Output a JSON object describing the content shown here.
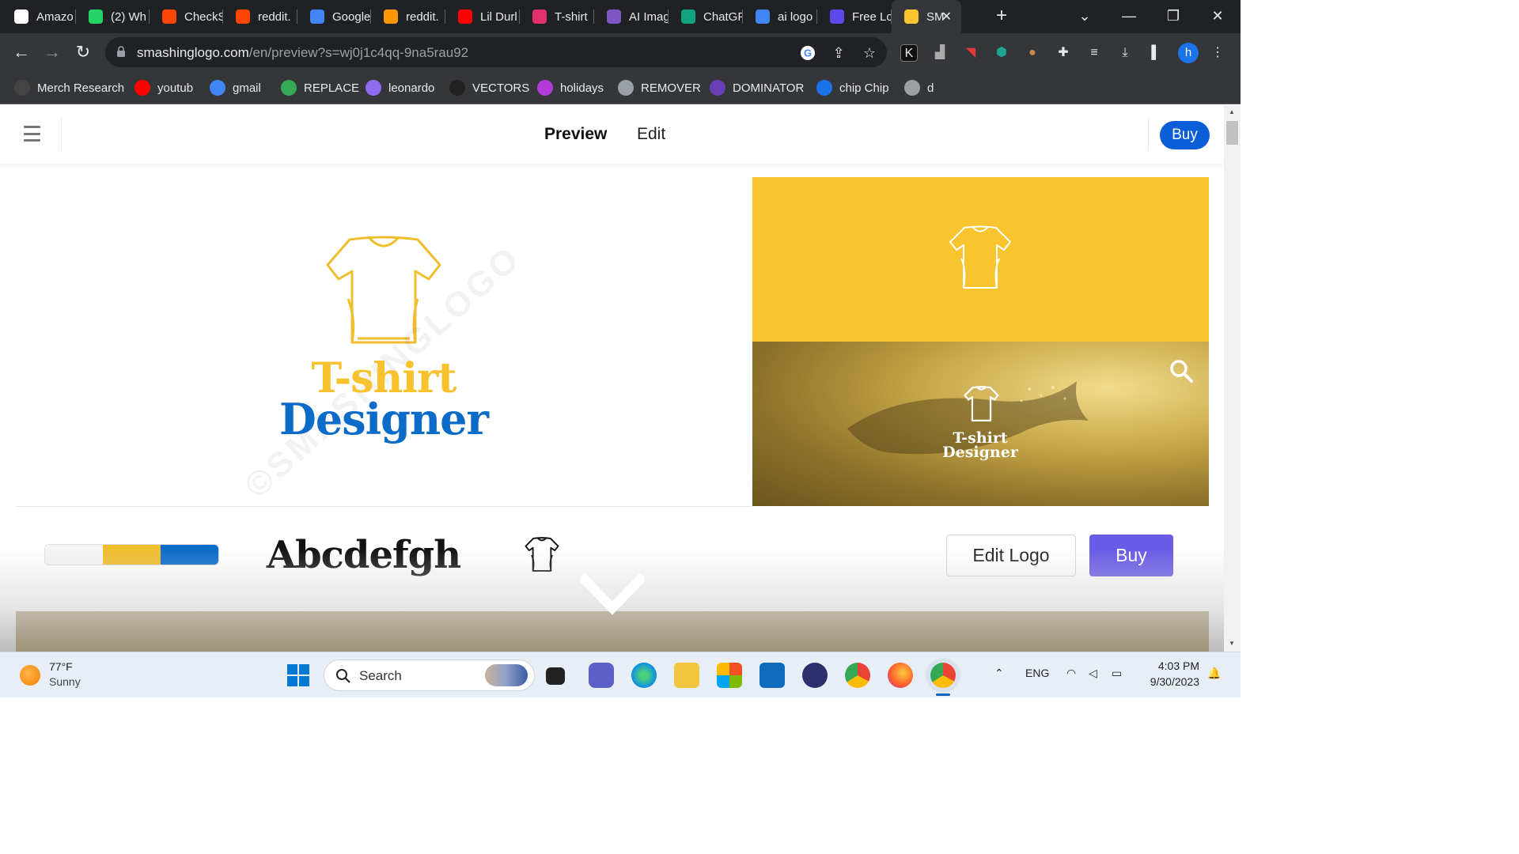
{
  "browser": {
    "tabs": [
      {
        "title": "Amazo",
        "icon": "amazon-icon",
        "color": "#ffffff"
      },
      {
        "title": "(2) Wh",
        "icon": "whatsapp-icon",
        "color": "#25d366"
      },
      {
        "title": "CheckS",
        "icon": "reddit-icon",
        "color": "#ff4500"
      },
      {
        "title": "reddit.",
        "icon": "reddit-icon",
        "color": "#ff4500"
      },
      {
        "title": "Google",
        "icon": "google-translate-icon",
        "color": "#4285f4"
      },
      {
        "title": "reddit.",
        "icon": "fire-icon",
        "color": "#ff9800"
      },
      {
        "title": "Lil Durl",
        "icon": "youtube-icon",
        "color": "#ff0000"
      },
      {
        "title": "T-shirt",
        "icon": "instagram-icon",
        "color": "#e1306c"
      },
      {
        "title": "AI Imag",
        "icon": "ai-image-icon",
        "color": "#7e57c2"
      },
      {
        "title": "ChatGF",
        "icon": "chatgpt-icon",
        "color": "#10a37f"
      },
      {
        "title": "ai logo",
        "icon": "google-icon",
        "color": "#4285f4"
      },
      {
        "title": "Free Lc",
        "icon": "free-logo-icon",
        "color": "#5b4ae8"
      },
      {
        "title": "SM",
        "icon": "smashinglogo-icon",
        "color": "#f8c52f"
      }
    ],
    "url_host": "smashinglogo.com",
    "url_path": "/en/preview?s=wj0j1c4qq-9na5rau92",
    "profile_initial": "h",
    "bookmarks": [
      {
        "label": "Merch Research",
        "icon": "merch-research-icon",
        "color": "#444444"
      },
      {
        "label": "youtub",
        "icon": "youtube-icon",
        "color": "#ff0000"
      },
      {
        "label": "gmail",
        "icon": "google-icon",
        "color": "#4285f4"
      },
      {
        "label": "REPLACE",
        "icon": "replace-icon",
        "color": "#34a853"
      },
      {
        "label": "leonardo",
        "icon": "leonardo-icon",
        "color": "#8e6cf1"
      },
      {
        "label": "VECTORS",
        "icon": "vectors-icon",
        "color": "#222222"
      },
      {
        "label": "holidays",
        "icon": "holidays-icon",
        "color": "#b23ad8"
      },
      {
        "label": "REMOVER",
        "icon": "remover-icon",
        "color": "#9aa0a6"
      },
      {
        "label": "DOMINATOR",
        "icon": "dominator-icon",
        "color": "#6a3fb5"
      },
      {
        "label": "chip Chip",
        "icon": "chip-icon",
        "color": "#1a73e8"
      },
      {
        "label": "d",
        "icon": "globe-icon",
        "color": "#9aa0a6"
      }
    ]
  },
  "site": {
    "nav": {
      "preview": "Preview",
      "edit": "Edit",
      "buy": "Buy"
    },
    "logo": {
      "line1": "T-shirt",
      "line2": "Designer"
    },
    "watermark": "©SMASHINGLOGO",
    "palette": [
      "#f4f4f4",
      "#f0bd2c",
      "#0b6bc9"
    ],
    "font_sample": "Abcdefgh",
    "edit_logo": "Edit Logo",
    "buy": "Buy",
    "colors": {
      "yellow": "#f7c22b",
      "blue": "#0b6bc9",
      "buy_purple": "#6a5ae8",
      "buy_blue": "#0b5ed7"
    }
  },
  "taskbar": {
    "temp": "77°F",
    "condition": "Sunny",
    "search": "Search",
    "lang": "ENG",
    "time": "4:03 PM",
    "date": "9/30/2023"
  }
}
